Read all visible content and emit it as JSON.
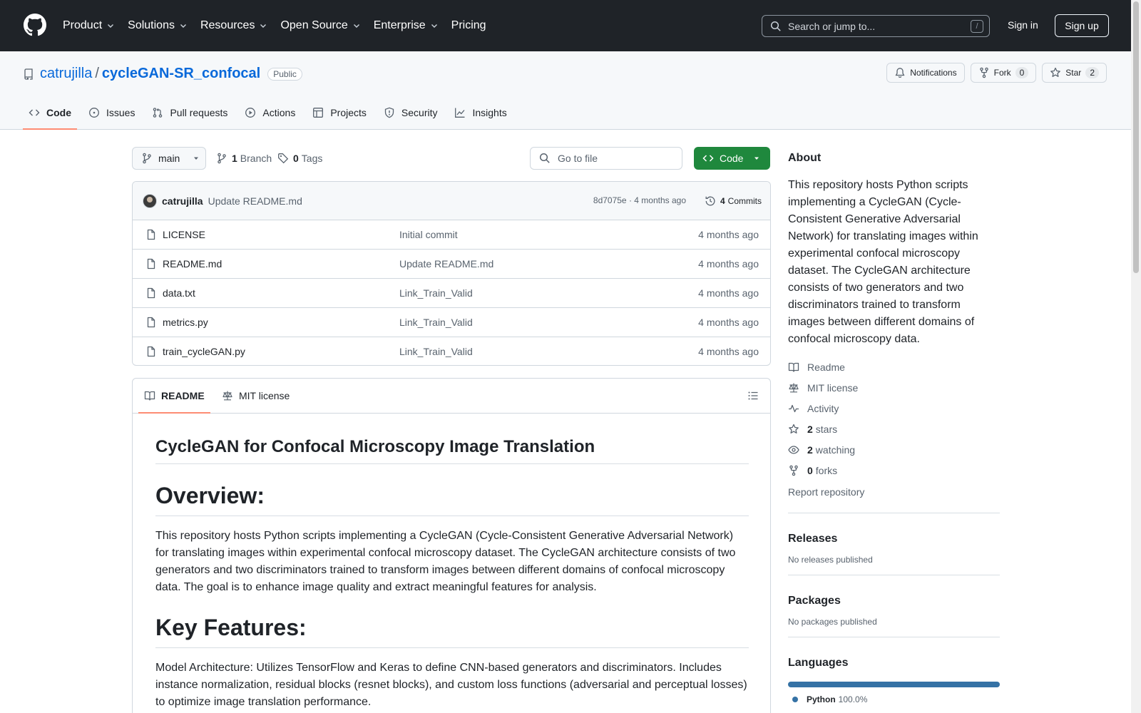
{
  "header": {
    "nav": [
      "Product",
      "Solutions",
      "Resources",
      "Open Source",
      "Enterprise",
      "Pricing"
    ],
    "search_placeholder": "Search or jump to...",
    "search_shortcut": "/",
    "sign_in": "Sign in",
    "sign_up": "Sign up"
  },
  "repo": {
    "owner": "catrujilla",
    "separator": "/",
    "name": "cycleGAN-SR_confocal",
    "visibility": "Public",
    "notifications_label": "Notifications",
    "fork_label": "Fork",
    "fork_count": "0",
    "star_label": "Star",
    "star_count": "2",
    "tabs": [
      "Code",
      "Issues",
      "Pull requests",
      "Actions",
      "Projects",
      "Security",
      "Insights"
    ]
  },
  "toolbar": {
    "branch": "main",
    "branches_count": "1",
    "branches_label": "Branch",
    "tags_count": "0",
    "tags_label": "Tags",
    "goto_placeholder": "Go to file",
    "code_label": "Code"
  },
  "commit": {
    "author": "catrujilla",
    "message": "Update README.md",
    "meta": "8d7075e · 4 months ago",
    "count": "4",
    "count_label": "Commits"
  },
  "files": [
    {
      "name": "LICENSE",
      "message": "Initial commit",
      "age": "4 months ago"
    },
    {
      "name": "README.md",
      "message": "Update README.md",
      "age": "4 months ago"
    },
    {
      "name": "data.txt",
      "message": "Link_Train_Valid",
      "age": "4 months ago"
    },
    {
      "name": "metrics.py",
      "message": "Link_Train_Valid",
      "age": "4 months ago"
    },
    {
      "name": "train_cycleGAN.py",
      "message": "Link_Train_Valid",
      "age": "4 months ago"
    }
  ],
  "readme": {
    "tab_readme": "README",
    "tab_license": "MIT license",
    "title": "CycleGAN for Confocal Microscopy Image Translation",
    "overview_heading": "Overview:",
    "overview_text": "This repository hosts Python scripts implementing a CycleGAN (Cycle-Consistent Generative Adversarial Network) for translating images within experimental confocal microscopy dataset. The CycleGAN architecture consists of two generators and two discriminators trained to transform images between different domains of confocal microscopy data. The goal is to enhance image quality and extract meaningful features for analysis.",
    "features_heading": "Key Features:",
    "features_text": "Model Architecture: Utilizes TensorFlow and Keras to define CNN-based generators and discriminators. Includes instance normalization, residual blocks (resnet blocks), and custom loss functions (adversarial and perceptual losses) to optimize image translation performance."
  },
  "about": {
    "heading": "About",
    "description": "This repository hosts Python scripts implementing a CycleGAN (Cycle-Consistent Generative Adversarial Network) for translating images within experimental confocal microscopy dataset. The CycleGAN architecture consists of two generators and two discriminators trained to transform images between different domains of confocal microscopy data.",
    "readme_link": "Readme",
    "license_link": "MIT license",
    "activity_link": "Activity",
    "stars_count": "2",
    "stars_label": "stars",
    "watching_count": "2",
    "watching_label": "watching",
    "forks_count": "0",
    "forks_label": "forks",
    "report": "Report repository"
  },
  "releases": {
    "heading": "Releases",
    "empty": "No releases published"
  },
  "packages": {
    "heading": "Packages",
    "empty": "No packages published"
  },
  "languages": {
    "heading": "Languages",
    "items": [
      {
        "name": "Python",
        "percent": "100.0%",
        "fraction": 1.0,
        "color": "#3572A5"
      }
    ]
  }
}
